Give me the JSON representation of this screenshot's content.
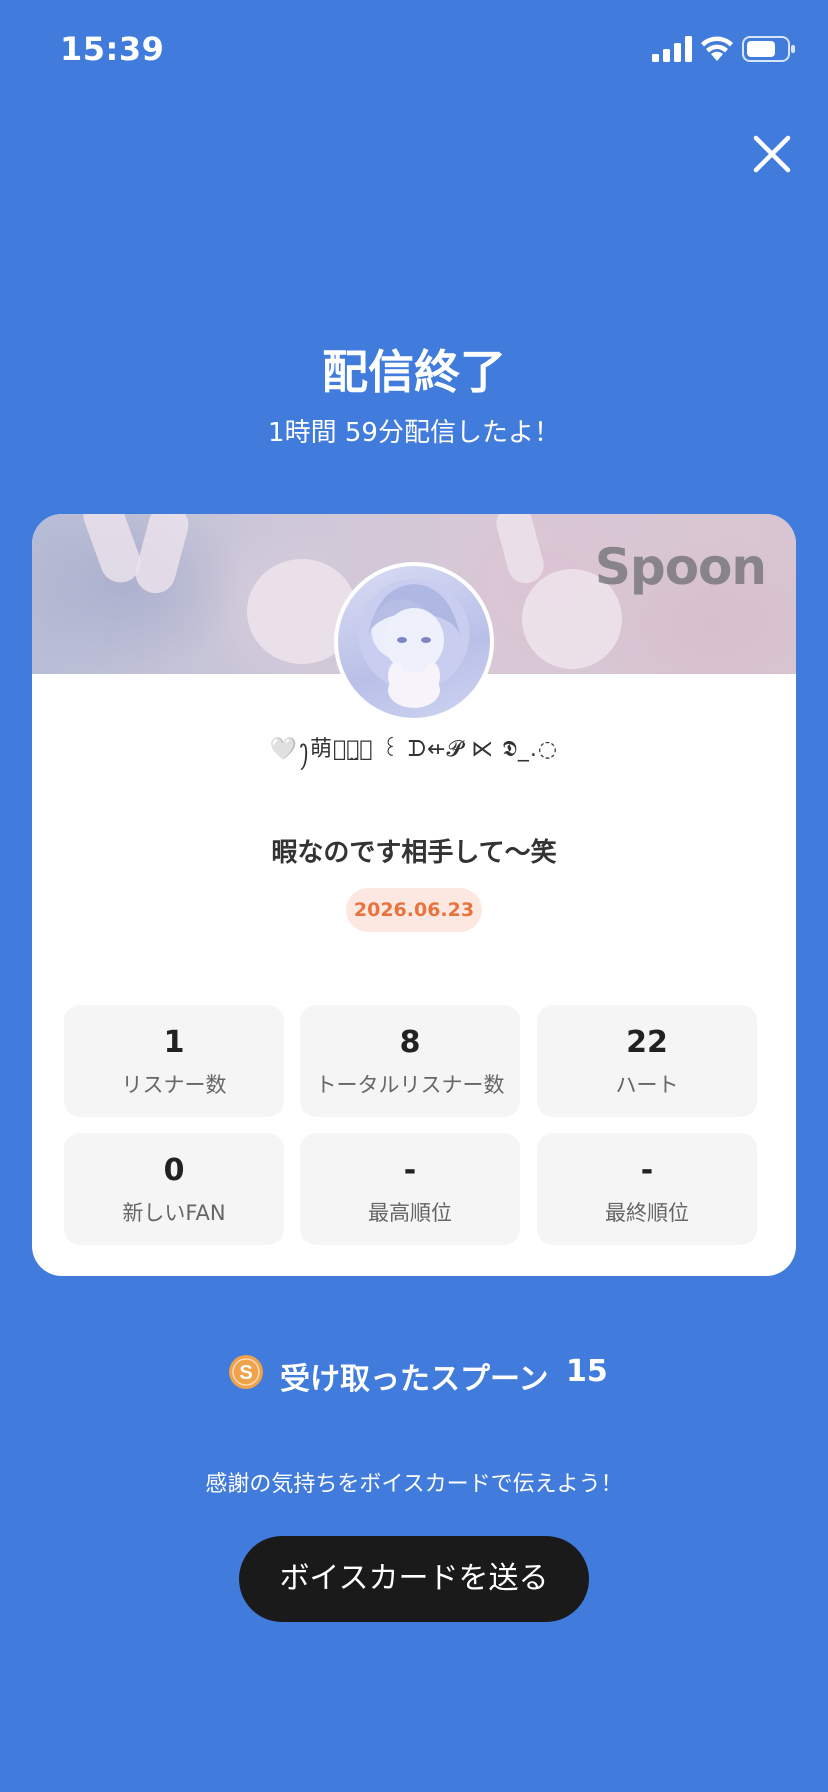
{
  "status_bar": {
    "time": "15:39",
    "icons": [
      "signal-icon",
      "wifi-icon",
      "battery-icon"
    ]
  },
  "header": {
    "close_icon": "close-icon",
    "title": "配信終了",
    "duration_text": "1時間 59分配信したよ！"
  },
  "card": {
    "banner_logo": "Spoon",
    "username": "🤍ꫂ萌叶⃝̤⃝ ꒰ ᗪ⇷𝓟 ⋉ 𝕯_.◌",
    "broadcast_title": "暇なのです相手して〜笑",
    "date": "2026.06.23",
    "stats": [
      {
        "value": "1",
        "label": "リスナー数"
      },
      {
        "value": "8",
        "label": "トータルリスナー数"
      },
      {
        "value": "22",
        "label": "ハート"
      },
      {
        "value": "0",
        "label": "新しいFAN"
      },
      {
        "value": "-",
        "label": "最高順位"
      },
      {
        "value": "-",
        "label": "最終順位"
      }
    ]
  },
  "spoons": {
    "icon": "spoon-coin-icon",
    "icon_letter": "S",
    "label": "受け取ったスプーン",
    "count": "15"
  },
  "footer": {
    "thanks_text": "感謝の気持ちをボイスカードで伝えよう！",
    "button_label": "ボイスカードを送る"
  },
  "colors": {
    "background": "#417bdb",
    "date_badge_bg": "#fde8e1",
    "date_badge_text": "#e8733e",
    "button_bg": "#1a1a1a",
    "coin": "#f0a24a"
  }
}
